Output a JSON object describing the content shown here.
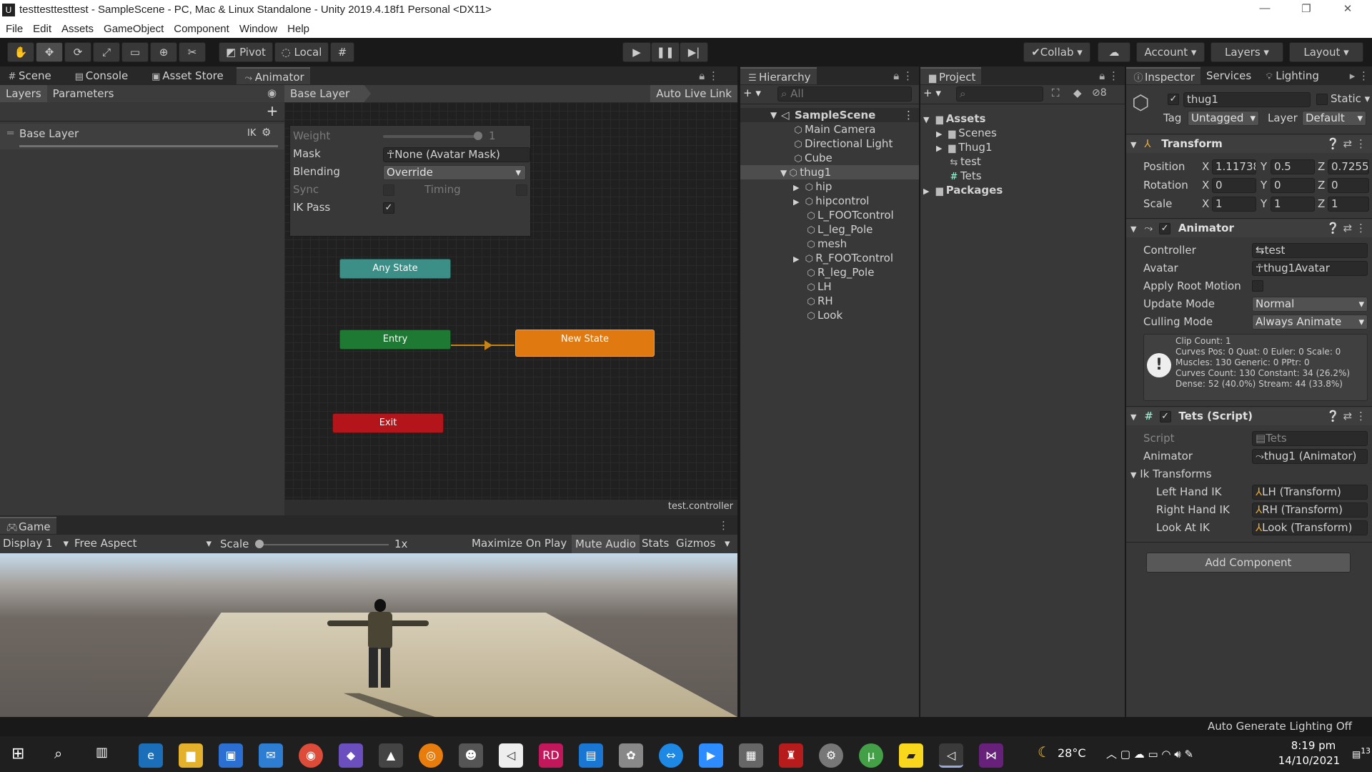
{
  "window": {
    "title": "testtesttesttest - SampleScene - PC, Mac & Linux Standalone - Unity 2019.4.18f1 Personal <DX11>",
    "logo": "U"
  },
  "menu": [
    "File",
    "Edit",
    "Assets",
    "GameObject",
    "Component",
    "Window",
    "Help"
  ],
  "toolbar": {
    "pivot": "Pivot",
    "local": "Local",
    "collab": "Collab",
    "account": "Account",
    "layers": "Layers",
    "layout": "Layout"
  },
  "tabs_top": [
    "Scene",
    "Console",
    "Asset Store",
    "Animator"
  ],
  "animator": {
    "subtabs": [
      "Layers",
      "Parameters"
    ],
    "breadcrumb": "Base Layer",
    "auto_live_link": "Auto Live Link",
    "layer_name": "Base Layer",
    "ik_label": "IK",
    "settings": {
      "weight_label": "Weight",
      "weight_value": "1",
      "mask_label": "Mask",
      "mask_value": "None (Avatar Mask)",
      "blending_label": "Blending",
      "blending_value": "Override",
      "sync_label": "Sync",
      "timing_label": "Timing",
      "ikpass_label": "IK Pass"
    },
    "nodes": {
      "any_state": "Any State",
      "entry": "Entry",
      "new_state": "New State",
      "exit": "Exit"
    },
    "footer": "test.controller"
  },
  "game": {
    "tab": "Game",
    "display": "Display 1",
    "aspect": "Free Aspect",
    "scale_label": "Scale",
    "scale_value": "1x",
    "maximize": "Maximize On Play",
    "mute": "Mute Audio",
    "stats": "Stats",
    "gizmos": "Gizmos"
  },
  "hierarchy": {
    "tab": "Hierarchy",
    "search_placeholder": "All",
    "scene": "SampleScene",
    "items": [
      "Main Camera",
      "Directional Light",
      "Cube",
      "thug1"
    ],
    "children": [
      "hip",
      "hipcontrol",
      "L_FOOTcontrol",
      "L_leg_Pole",
      "mesh",
      "R_FOOTcontrol",
      "R_leg_Pole",
      "LH",
      "RH",
      "Look"
    ]
  },
  "project": {
    "tab": "Project",
    "badge": "8",
    "assets": "Assets",
    "asset_items": [
      "Scenes",
      "Thug1",
      "test",
      "Tets"
    ],
    "packages": "Packages"
  },
  "inspector": {
    "tabs": [
      "Inspector",
      "Services",
      "Lighting"
    ],
    "object_name": "thug1",
    "static_label": "Static",
    "tag_label": "Tag",
    "tag_value": "Untagged",
    "layer_label": "Layer",
    "layer_value": "Default",
    "transform": {
      "title": "Transform",
      "position_label": "Position",
      "rotation_label": "Rotation",
      "scale_label": "Scale",
      "position": [
        "1.11738",
        "0.5",
        "0.7255"
      ],
      "rotation": [
        "0",
        "0",
        "0"
      ],
      "scale": [
        "1",
        "1",
        "1"
      ]
    },
    "animator": {
      "title": "Animator",
      "controller_label": "Controller",
      "controller_value": "test",
      "avatar_label": "Avatar",
      "avatar_value": "thug1Avatar",
      "apply_root_label": "Apply Root Motion",
      "update_label": "Update Mode",
      "update_value": "Normal",
      "culling_label": "Culling Mode",
      "culling_value": "Always Animate",
      "info": [
        "Clip Count: 1",
        "Curves Pos: 0 Quat: 0 Euler: 0 Scale: 0",
        "Muscles: 130 Generic: 0 PPtr: 0",
        "Curves Count: 130 Constant: 34 (26.2%)",
        "Dense: 52 (40.0%) Stream: 44 (33.8%)"
      ]
    },
    "tets": {
      "title": "Tets (Script)",
      "script_label": "Script",
      "script_value": "Tets",
      "animator_label": "Animator",
      "animator_value": "thug1 (Animator)",
      "ik_transforms_label": "Ik Transforms",
      "left_label": "Left Hand IK",
      "left_value": "LH (Transform)",
      "right_label": "Right Hand IK",
      "right_value": "RH (Transform)",
      "look_label": "Look At IK",
      "look_value": "Look (Transform)"
    },
    "add_component": "Add Component"
  },
  "statusbar": {
    "text": "Auto Generate Lighting Off"
  },
  "taskbar": {
    "temperature": "28°C",
    "time": "8:19 pm",
    "date": "14/10/2021",
    "notifications": "13"
  }
}
